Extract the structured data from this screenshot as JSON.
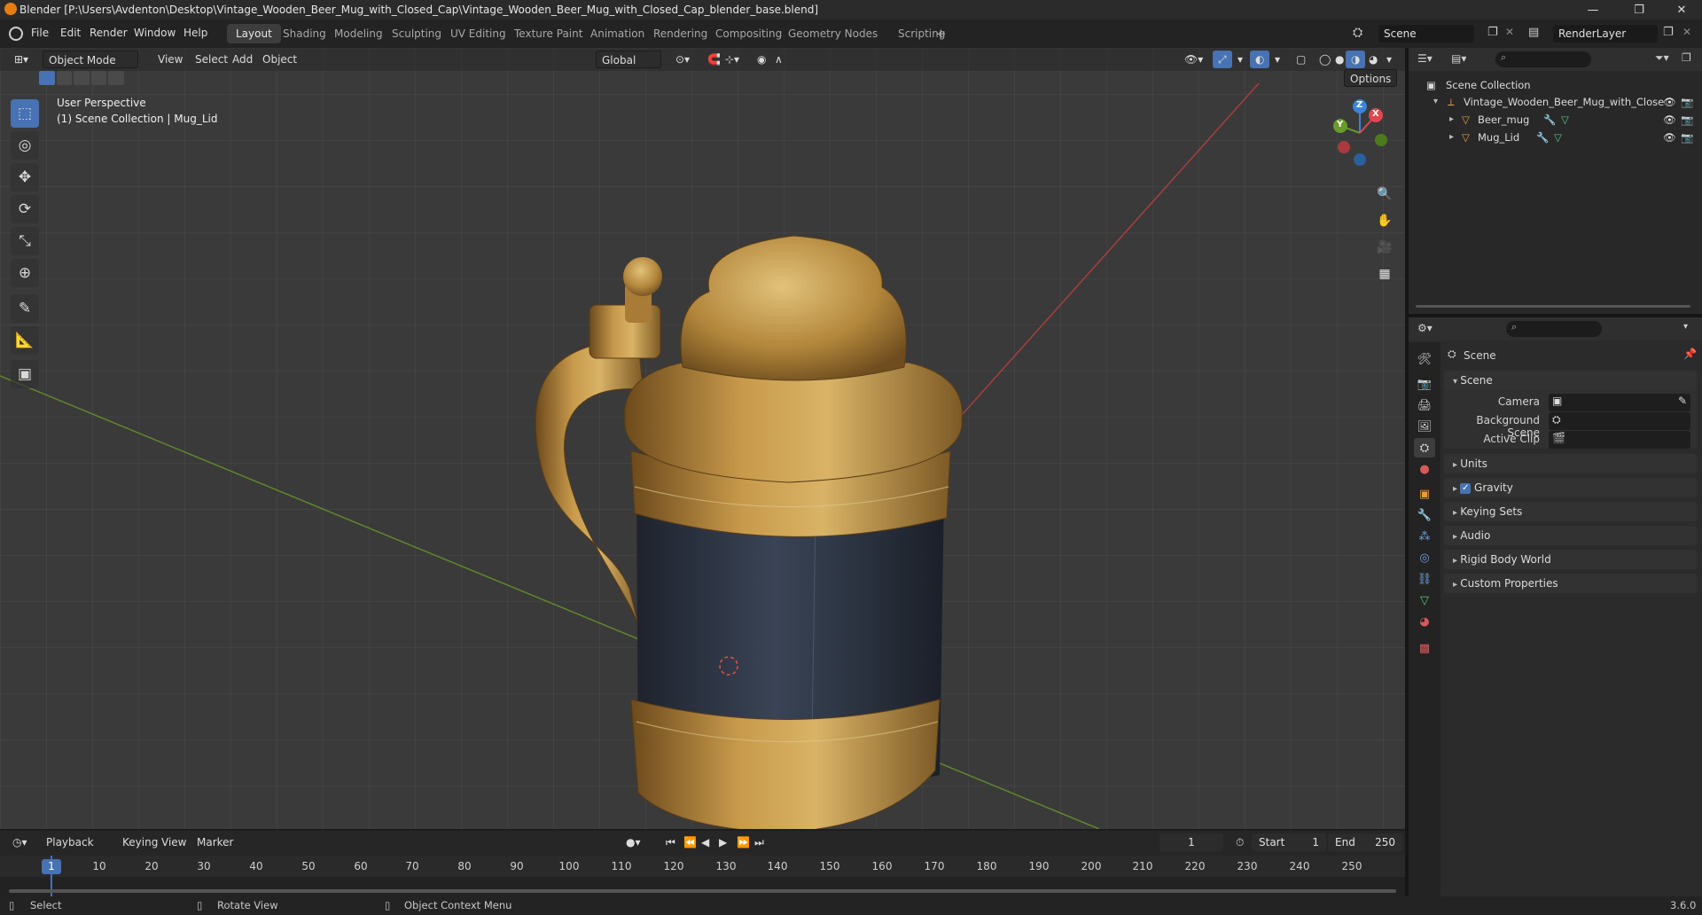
{
  "window": {
    "title": "Blender [P:\\Users\\Avdenton\\Desktop\\Vintage_Wooden_Beer_Mug_with_Closed_Cap\\Vintage_Wooden_Beer_Mug_with_Closed_Cap_blender_base.blend]",
    "controls": [
      "—",
      "❐",
      "✕"
    ]
  },
  "menubar": {
    "items": [
      "File",
      "Edit",
      "Render",
      "Window",
      "Help"
    ],
    "workspaces": [
      "Layout",
      "Shading",
      "Modeling",
      "Sculpting",
      "UV Editing",
      "Texture Paint",
      "Animation",
      "Rendering",
      "Compositing",
      "Geometry Nodes",
      "Scripting"
    ],
    "active_workspace": "Layout",
    "add_workspace": "+",
    "scene": "Scene",
    "render_layer": "RenderLayer"
  },
  "viewport": {
    "mode": "Object Mode",
    "menus": [
      "View",
      "Select",
      "Add",
      "Object"
    ],
    "transform_orientation": "Global",
    "options": "Options",
    "overlay_line1": "User Perspective",
    "overlay_line2": "(1) Scene Collection | Mug_Lid",
    "gizmo": {
      "z": "Z",
      "y": "Y",
      "x": "X"
    }
  },
  "outliner": {
    "root": "Scene Collection",
    "collection": "Vintage_Wooden_Beer_Mug_with_Close",
    "objects": [
      "Beer_mug",
      "Mug_Lid"
    ]
  },
  "properties": {
    "context": "Scene",
    "section": "Scene",
    "fields": [
      {
        "label": "Camera"
      },
      {
        "label": "Background Scene"
      },
      {
        "label": "Active Clip"
      }
    ],
    "panels": [
      "Units",
      "Gravity",
      "Keying Sets",
      "Audio",
      "Rigid Body World",
      "Custom Properties"
    ],
    "gravity_checked": true
  },
  "timeline": {
    "menus": [
      "Playback",
      "Keying",
      "View",
      "Marker"
    ],
    "current_frame": "1",
    "start_label": "Start",
    "start": "1",
    "end_label": "End",
    "end": "250",
    "ticks": [
      "1",
      "10",
      "20",
      "30",
      "40",
      "50",
      "60",
      "70",
      "80",
      "90",
      "100",
      "110",
      "120",
      "130",
      "140",
      "150",
      "160",
      "170",
      "180",
      "190",
      "200",
      "210",
      "220",
      "230",
      "240",
      "250"
    ]
  },
  "statusbar": {
    "select": "Select",
    "rotate": "Rotate View",
    "context_menu": "Object Context Menu",
    "version": "3.6.0"
  },
  "colors": {
    "accent": "#4772b3",
    "x_axis": "#e0474f",
    "y_axis": "#6a9a2a",
    "z_axis": "#3a84d8",
    "brass": "#b8893a",
    "wood": "#2c3442"
  }
}
